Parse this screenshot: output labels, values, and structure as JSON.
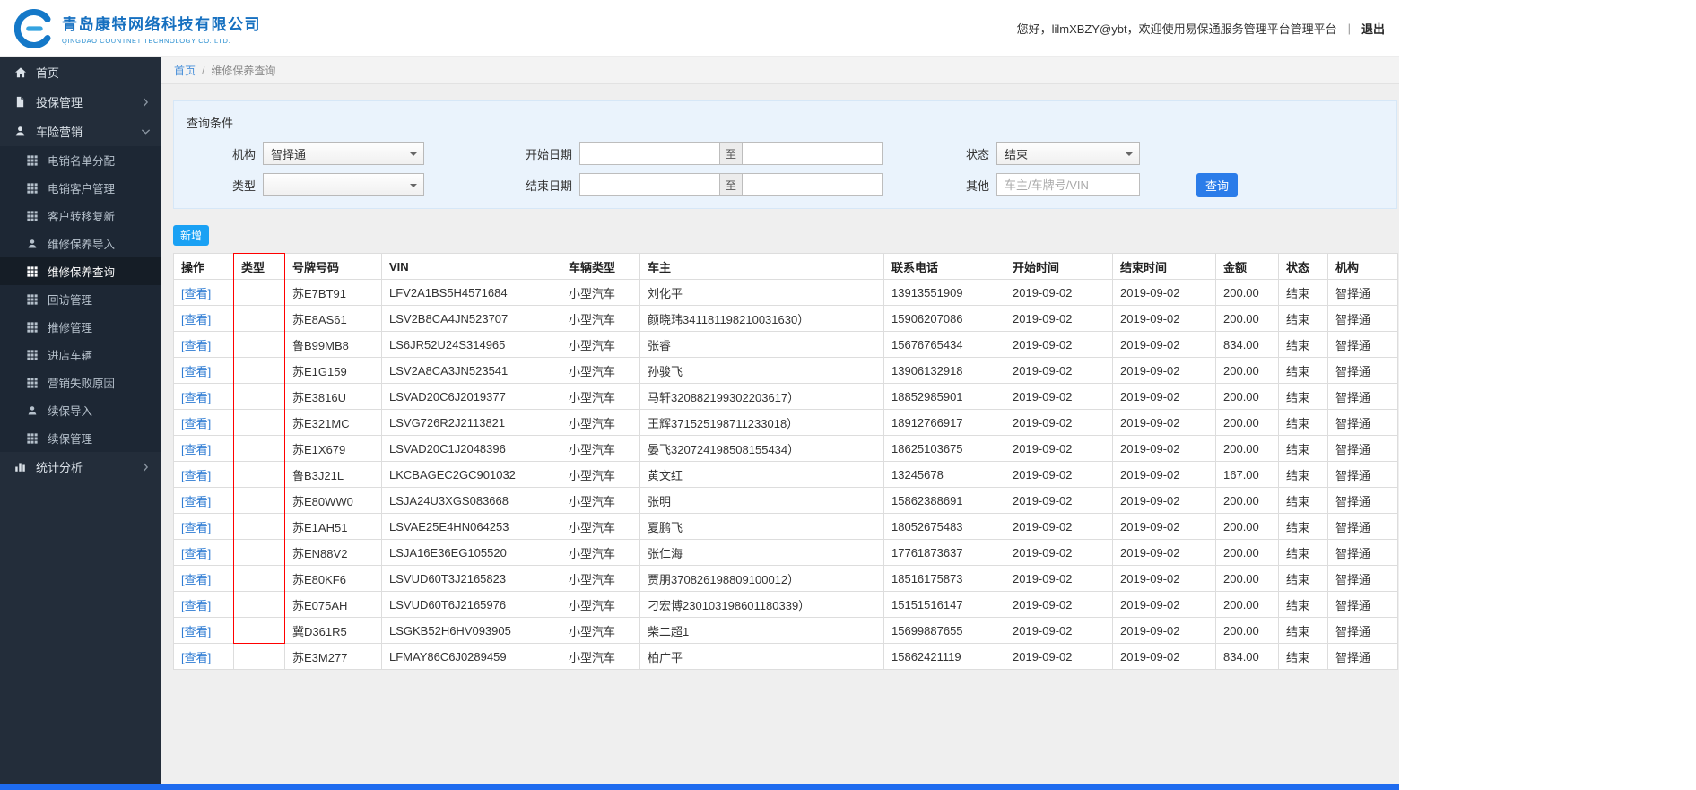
{
  "colors": {
    "accent_blue": "#1aa1f4",
    "button_blue": "#2b7ce9",
    "link_blue": "#2f7cd3",
    "brand_blue": "#1670c0",
    "sidebar_bg": "#232d3a",
    "sidebar_sub_bg": "#1d2734",
    "sidebar_active_bg": "#151d26",
    "panel_blue": "#eaf3fc",
    "highlight_red": "#ff0000",
    "scrollbar_blue": "#1e6bef"
  },
  "header": {
    "company_cn": "青岛康特网络科技有限公司",
    "company_en": "QINGDAO COUNTNET TECHNOLOGY CO.,LTD.",
    "welcome": "您好，lilmXBZY@ybt，欢迎使用易保通服务管理平台管理平台",
    "separator": "|",
    "logout": "退出"
  },
  "sidebar": {
    "items": [
      {
        "label": "首页",
        "icon": "home-icon",
        "type": "top"
      },
      {
        "label": "投保管理",
        "icon": "document-icon",
        "type": "top",
        "chevron": "right"
      },
      {
        "label": "车险营销",
        "icon": "agent-icon",
        "type": "top",
        "chevron": "down",
        "expanded": true
      },
      {
        "label": "电销名单分配",
        "icon": "grid-icon",
        "type": "sub"
      },
      {
        "label": "电销客户管理",
        "icon": "grid-icon",
        "type": "sub"
      },
      {
        "label": "客户转移复新",
        "icon": "grid-icon",
        "type": "sub"
      },
      {
        "label": "维修保养导入",
        "icon": "person-icon",
        "type": "sub"
      },
      {
        "label": "维修保养查询",
        "icon": "grid-icon",
        "type": "sub",
        "active": true
      },
      {
        "label": "回访管理",
        "icon": "grid-icon",
        "type": "sub"
      },
      {
        "label": "推修管理",
        "icon": "grid-icon",
        "type": "sub"
      },
      {
        "label": "进店车辆",
        "icon": "grid-icon",
        "type": "sub"
      },
      {
        "label": "营销失败原因",
        "icon": "grid-icon",
        "type": "sub"
      },
      {
        "label": "续保导入",
        "icon": "person-icon",
        "type": "sub"
      },
      {
        "label": "续保管理",
        "icon": "grid-icon",
        "type": "sub"
      },
      {
        "label": "统计分析",
        "icon": "chart-icon",
        "type": "top",
        "chevron": "right"
      }
    ]
  },
  "breadcrumb": {
    "home": "首页",
    "separator": "/",
    "current": "维修保养查询"
  },
  "query": {
    "title": "查询条件",
    "fields": {
      "org_label": "机构",
      "org_value": "智择通",
      "type_label": "类型",
      "type_value": "",
      "start_label": "开始日期",
      "end_label": "结束日期",
      "to": "至",
      "status_label": "状态",
      "status_value": "结束",
      "other_label": "其他",
      "other_placeholder": "车主/车牌号/VIN",
      "search_button": "查询"
    }
  },
  "toolbar": {
    "add_button": "新增"
  },
  "table": {
    "columns": [
      "操作",
      "类型",
      "号牌号码",
      "VIN",
      "车辆类型",
      "车主",
      "联系电话",
      "开始时间",
      "结束时间",
      "金额",
      "状态",
      "机构"
    ],
    "view_label": "[查看]",
    "rows": [
      [
        "",
        "苏E7BT91",
        "LFV2A1BS5H4571684",
        "小型汽车",
        "刘化平",
        "13913551909",
        "2019-09-02",
        "2019-09-02",
        "200.00",
        "结束",
        "智择通"
      ],
      [
        "",
        "苏E8AS61",
        "LSV2B8CA4JN523707",
        "小型汽车",
        "颜晓玮341181198210031630）",
        "15906207086",
        "2019-09-02",
        "2019-09-02",
        "200.00",
        "结束",
        "智择通"
      ],
      [
        "",
        "鲁B99MB8",
        "LS6JR52U24S314965",
        "小型汽车",
        "张睿",
        "15676765434",
        "2019-09-02",
        "2019-09-02",
        "834.00",
        "结束",
        "智择通"
      ],
      [
        "",
        "苏E1G159",
        "LSV2A8CA3JN523541",
        "小型汽车",
        "孙骏飞",
        "13906132918",
        "2019-09-02",
        "2019-09-02",
        "200.00",
        "结束",
        "智择通"
      ],
      [
        "",
        "苏E3816U",
        "LSVAD20C6J2019377",
        "小型汽车",
        "马轩320882199302203617）",
        "18852985901",
        "2019-09-02",
        "2019-09-02",
        "200.00",
        "结束",
        "智择通"
      ],
      [
        "",
        "苏E321MC",
        "LSVG726R2J2113821",
        "小型汽车",
        "王辉371525198711233018）",
        "18912766917",
        "2019-09-02",
        "2019-09-02",
        "200.00",
        "结束",
        "智择通"
      ],
      [
        "",
        "苏E1X679",
        "LSVAD20C1J2048396",
        "小型汽车",
        "晏飞320724198508155434）",
        "18625103675",
        "2019-09-02",
        "2019-09-02",
        "200.00",
        "结束",
        "智择通"
      ],
      [
        "",
        "鲁B3J21L",
        "LKCBAGEC2GC901032",
        "小型汽车",
        "黄文红",
        "13245678",
        "2019-09-02",
        "2019-09-02",
        "167.00",
        "结束",
        "智择通"
      ],
      [
        "",
        "苏E80WW0",
        "LSJA24U3XGS083668",
        "小型汽车",
        "张明",
        "15862388691",
        "2019-09-02",
        "2019-09-02",
        "200.00",
        "结束",
        "智择通"
      ],
      [
        "",
        "苏E1AH51",
        "LSVAE25E4HN064253",
        "小型汽车",
        "夏鹏飞",
        "18052675483",
        "2019-09-02",
        "2019-09-02",
        "200.00",
        "结束",
        "智择通"
      ],
      [
        "",
        "苏EN88V2",
        "LSJA16E36EG105520",
        "小型汽车",
        "张仁海",
        "17761873637",
        "2019-09-02",
        "2019-09-02",
        "200.00",
        "结束",
        "智择通"
      ],
      [
        "",
        "苏E80KF6",
        "LSVUD60T3J2165823",
        "小型汽车",
        "贾朋370826198809100012）",
        "18516175873",
        "2019-09-02",
        "2019-09-02",
        "200.00",
        "结束",
        "智择通"
      ],
      [
        "",
        "苏E075AH",
        "LSVUD60T6J2165976",
        "小型汽车",
        "刁宏博230103198601180339）",
        "15151516147",
        "2019-09-02",
        "2019-09-02",
        "200.00",
        "结束",
        "智择通"
      ],
      [
        "",
        "冀D361R5",
        "LSGKB52H6HV093905",
        "小型汽车",
        "柴二超1",
        "15699887655",
        "2019-09-02",
        "2019-09-02",
        "200.00",
        "结束",
        "智择通"
      ],
      [
        "",
        "苏E3M277",
        "LFMAY86C6J0289459",
        "小型汽车",
        "柏广平",
        "15862421119",
        "2019-09-02",
        "2019-09-02",
        "834.00",
        "结束",
        "智择通"
      ]
    ]
  }
}
